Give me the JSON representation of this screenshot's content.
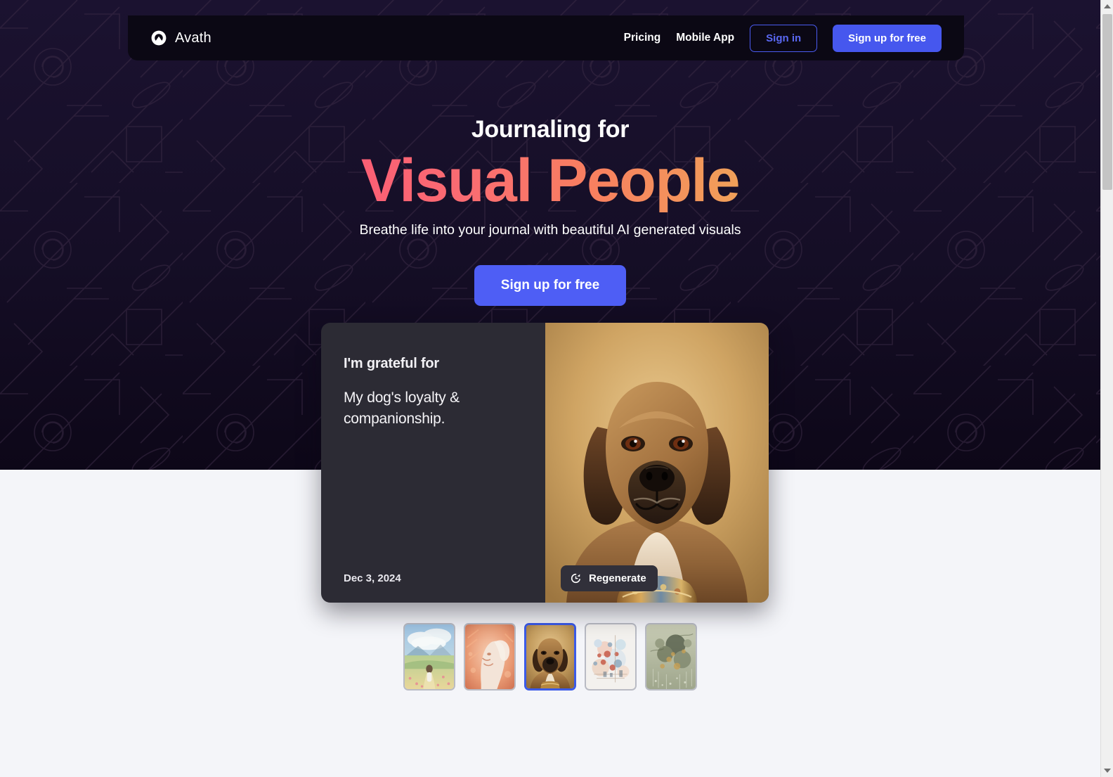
{
  "brand": {
    "name": "Avath",
    "logo_icon": "avath-logo-icon"
  },
  "nav": {
    "links": [
      {
        "label": "Pricing",
        "name": "pricing"
      },
      {
        "label": "Mobile App",
        "name": "mobile-app"
      }
    ],
    "sign_in_label": "Sign in",
    "sign_up_label": "Sign up for free"
  },
  "hero": {
    "headline_small": "Journaling for",
    "headline_big": "Visual People",
    "subhead": "Breathe life into your journal with beautiful AI generated visuals",
    "cta_label": "Sign up for free",
    "background_color": "#140e22",
    "gradient_from": "#fb5f74",
    "gradient_to": "#f0a059",
    "accent_blue": "#4e5ef5"
  },
  "journal_card": {
    "prompt": "I'm grateful for",
    "entry": "My dog's loyalty & companionship.",
    "date": "Dec 3, 2024",
    "regenerate_label": "Regenerate",
    "regenerate_icon": "refresh-icon",
    "card_background": "#2c2b34",
    "image_alt": "dog-portrait"
  },
  "thumbnails": [
    {
      "name": "thumbnail-meadow-walk",
      "selected": false
    },
    {
      "name": "thumbnail-orange-portrait",
      "selected": false
    },
    {
      "name": "thumbnail-dog-portrait",
      "selected": true
    },
    {
      "name": "thumbnail-abstract-collage",
      "selected": false
    },
    {
      "name": "thumbnail-surreal-forest",
      "selected": false
    }
  ],
  "page": {
    "light_background": "#f4f5f9",
    "selected_border_color": "#3b5be8"
  },
  "scrollbar": {
    "up_arrow": "scroll-up-arrow",
    "down_arrow": "scroll-down-arrow"
  }
}
